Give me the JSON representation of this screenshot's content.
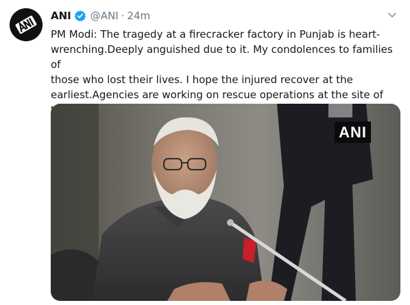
{
  "tweet": {
    "author_name": "ANI",
    "verified": true,
    "handle": "@ANI",
    "separator": "·",
    "timestamp": "24m",
    "text": "PM Modi: The tragedy at a firecracker factory in Punjab is heart-\nwrenching.Deeply anguished due to it. My condolences to families of\nthose who lost their lives. I hope the injured recover at the\nearliest.Agencies are working on rescue operations at the site of\ntragedy. (file pic)",
    "media": {
      "watermark": "ANI"
    }
  },
  "colors": {
    "text": "#14171a",
    "secondary": "#657786",
    "verified_blue": "#1da1f2"
  },
  "icons": {
    "verified": "verified-badge-icon",
    "menu": "chevron-down-icon"
  }
}
